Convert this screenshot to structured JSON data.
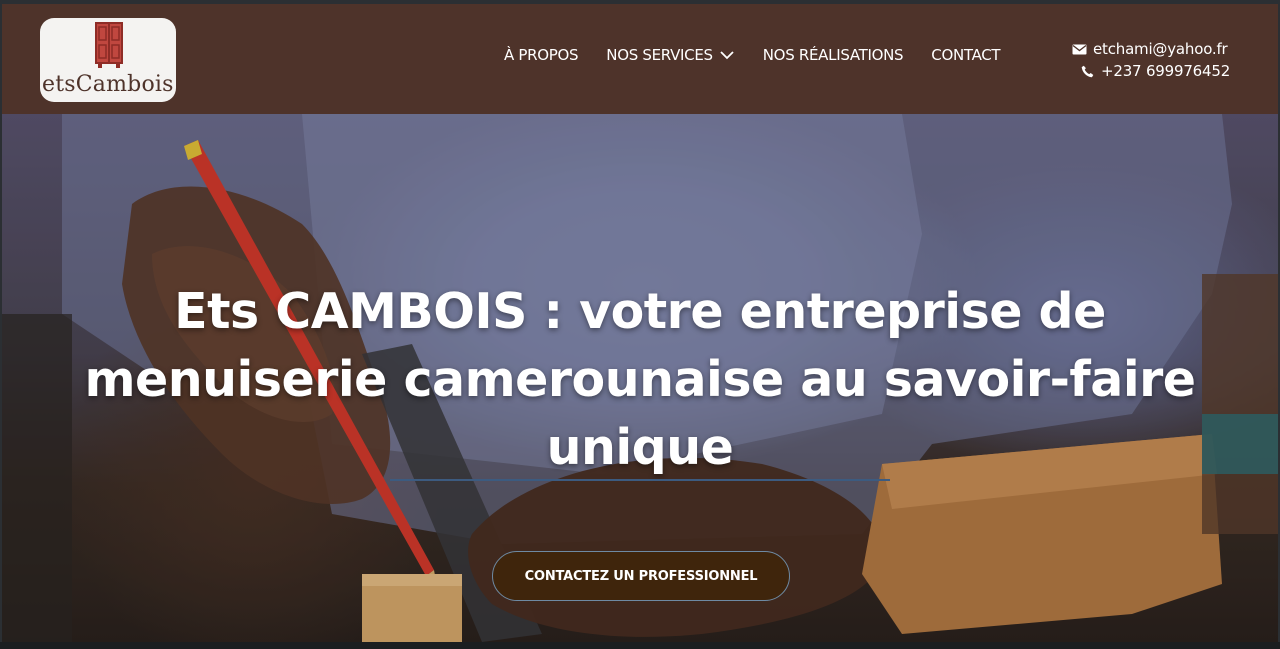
{
  "header": {
    "logo_text": "etsCambois",
    "logo_icon": "wardrobe-icon",
    "nav": [
      {
        "label": "À PROPOS"
      },
      {
        "label": "NOS SERVICES",
        "icon": "chevron-down-icon"
      },
      {
        "label": "NOS RÉALISATIONS"
      },
      {
        "label": "CONTACT"
      }
    ],
    "email": "etchami@yahoo.fr",
    "phone": "+237 699976452"
  },
  "hero": {
    "title": "Ets CAMBOIS : votre entreprise de menuiserie camerounaise au savoir-faire unique",
    "cta_label": "CONTACTEZ UN PROFESSIONNEL"
  },
  "colors": {
    "header_bg": "#4e332a",
    "cta_bg": "#3f250c",
    "logo_accent": "#c0392b"
  }
}
